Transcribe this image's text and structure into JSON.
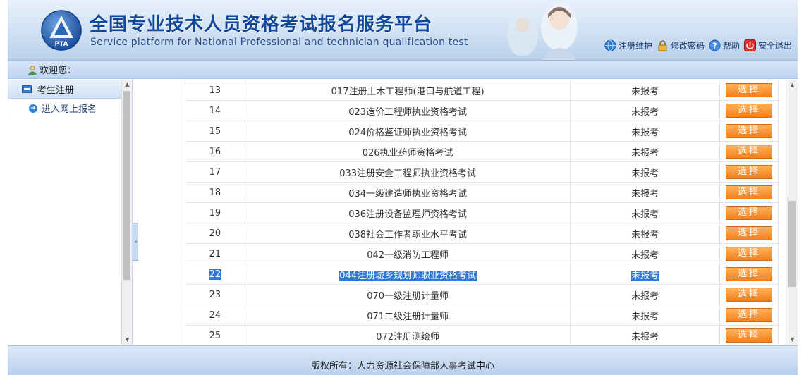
{
  "header": {
    "logo_text": "PTA",
    "title_zh": "全国专业技术人员资格考试报名服务平台",
    "title_en": "Service platform for National Professional and technician qualification test",
    "links": [
      {
        "label": "注册维护",
        "icon": "globe-icon"
      },
      {
        "label": "修改密码",
        "icon": "lock-icon"
      },
      {
        "label": "帮助",
        "icon": "help-icon"
      },
      {
        "label": "安全退出",
        "icon": "power-icon"
      }
    ]
  },
  "welcome": {
    "text": "欢迎您："
  },
  "sidebar": {
    "section": "考生注册",
    "items": [
      {
        "label": "进入网上报名"
      }
    ]
  },
  "table": {
    "rows": [
      {
        "num": "13",
        "name": "017注册土木工程师(港口与航道工程)",
        "status": "未报考",
        "action": "选择"
      },
      {
        "num": "14",
        "name": "023造价工程师执业资格考试",
        "status": "未报考",
        "action": "选择"
      },
      {
        "num": "15",
        "name": "024价格鉴证师执业资格考试",
        "status": "未报考",
        "action": "选择"
      },
      {
        "num": "16",
        "name": "026执业药师资格考试",
        "status": "未报考",
        "action": "选择"
      },
      {
        "num": "17",
        "name": "033注册安全工程师执业资格考试",
        "status": "未报考",
        "action": "选择"
      },
      {
        "num": "18",
        "name": "034一级建造师执业资格考试",
        "status": "未报考",
        "action": "选择"
      },
      {
        "num": "19",
        "name": "036注册设备监理师资格考试",
        "status": "未报考",
        "action": "选择"
      },
      {
        "num": "20",
        "name": "038社会工作者职业水平考试",
        "status": "未报考",
        "action": "选择"
      },
      {
        "num": "21",
        "name": "042一级消防工程师",
        "status": "未报考",
        "action": "选择"
      },
      {
        "num": "22",
        "name": "044注册城乡规划师职业资格考试",
        "status": "未报考",
        "action": "选择",
        "highlighted": true
      },
      {
        "num": "23",
        "name": "070一级注册计量师",
        "status": "未报考",
        "action": "选择"
      },
      {
        "num": "24",
        "name": "071二级注册计量师",
        "status": "未报考",
        "action": "选择"
      },
      {
        "num": "25",
        "name": "072注册测绘师",
        "status": "未报考",
        "action": "选择"
      }
    ]
  },
  "footer": {
    "text": "版权所有：人力资源社会保障部人事考试中心"
  },
  "colors": {
    "brand_blue": "#13479a",
    "button_orange": "#f3801f",
    "selection_blue": "#3378d3"
  }
}
